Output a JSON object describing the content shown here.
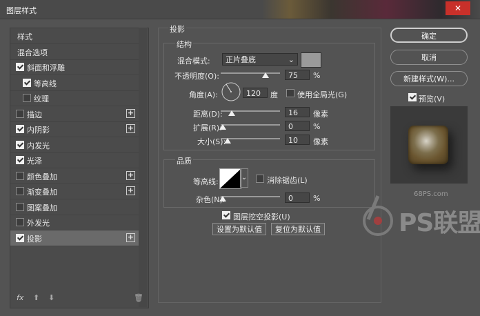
{
  "window": {
    "title": "图层样式",
    "close": "✕"
  },
  "styles_list": {
    "items": [
      {
        "label": "样式",
        "checkbox": false,
        "checked": false,
        "plus": false,
        "selected": false
      },
      {
        "label": "混合选项",
        "checkbox": false,
        "checked": false,
        "plus": false,
        "selected": false
      },
      {
        "label": "斜面和浮雕",
        "checkbox": true,
        "checked": true,
        "plus": false,
        "selected": false
      },
      {
        "label": "等高线",
        "checkbox": true,
        "checked": true,
        "plus": false,
        "selected": false,
        "indent": true
      },
      {
        "label": "纹理",
        "checkbox": true,
        "checked": false,
        "plus": false,
        "selected": false,
        "indent": true
      },
      {
        "label": "描边",
        "checkbox": true,
        "checked": false,
        "plus": true,
        "selected": false
      },
      {
        "label": "内阴影",
        "checkbox": true,
        "checked": true,
        "plus": true,
        "selected": false
      },
      {
        "label": "内发光",
        "checkbox": true,
        "checked": true,
        "plus": false,
        "selected": false
      },
      {
        "label": "光泽",
        "checkbox": true,
        "checked": true,
        "plus": false,
        "selected": false
      },
      {
        "label": "颜色叠加",
        "checkbox": true,
        "checked": false,
        "plus": true,
        "selected": false
      },
      {
        "label": "渐变叠加",
        "checkbox": true,
        "checked": false,
        "plus": true,
        "selected": false
      },
      {
        "label": "图案叠加",
        "checkbox": true,
        "checked": false,
        "plus": false,
        "selected": false
      },
      {
        "label": "外发光",
        "checkbox": true,
        "checked": false,
        "plus": false,
        "selected": false
      },
      {
        "label": "投影",
        "checkbox": true,
        "checked": true,
        "plus": true,
        "selected": true
      }
    ],
    "bottom_icons": {
      "fx": "fx",
      "up": "⬆",
      "down": "⬇",
      "trash": "🗑"
    }
  },
  "drop_shadow": {
    "section_title": "投影",
    "structure": {
      "title": "结构",
      "blend_mode_label": "混合模式:",
      "blend_mode_value": "正片叠底",
      "opacity_label": "不透明度(O):",
      "opacity_value": "75",
      "opacity_unit": "%",
      "opacity_level": 75,
      "angle_label": "角度(A):",
      "angle_value": "120",
      "angle_unit": "度",
      "global_light_label": "使用全局光(G)",
      "global_light_checked": false,
      "distance_label": "距离(D):",
      "distance_value": "16",
      "distance_unit": "像素",
      "spread_label": "扩展(R):",
      "spread_value": "0",
      "spread_unit": "%",
      "size_label": "大小(S):",
      "size_value": "10",
      "size_unit": "像素"
    },
    "quality": {
      "title": "品质",
      "contour_label": "等高线:",
      "antialias_label": "消除锯齿(L)",
      "antialias_checked": false,
      "noise_label": "杂色(N):",
      "noise_value": "0",
      "noise_unit": "%"
    },
    "knockout_label": "图层挖空投影(U)",
    "knockout_checked": true,
    "set_default_label": "设置为默认值",
    "reset_default_label": "复位为默认值"
  },
  "right_panel": {
    "ok_label": "确定",
    "cancel_label": "取消",
    "new_style_label": "新建样式(W)...",
    "preview_label": "预览(V)",
    "preview_checked": true
  },
  "watermark": {
    "site": "68PS.com",
    "brand": "PS联盟"
  },
  "colors": {
    "shadow_swatch": "#9a9a9a",
    "close_button": "#c8302a"
  }
}
